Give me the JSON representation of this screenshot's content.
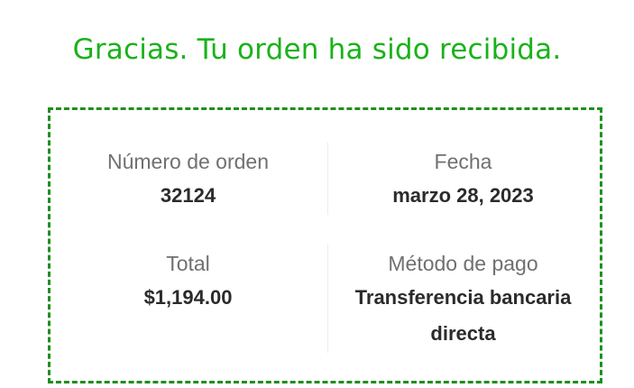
{
  "confirmation": {
    "title": "Gracias. Tu orden ha sido recibida."
  },
  "order": {
    "number_label": "Número de orden",
    "number_value": "32124",
    "date_label": "Fecha",
    "date_value": "marzo 28, 2023",
    "total_label": "Total",
    "total_value": "$1,194.00",
    "payment_label": "Método de pago",
    "payment_value": "Transferencia bancaria directa"
  },
  "colors": {
    "title": "#1ab21a",
    "border": "#1f8f1f"
  }
}
